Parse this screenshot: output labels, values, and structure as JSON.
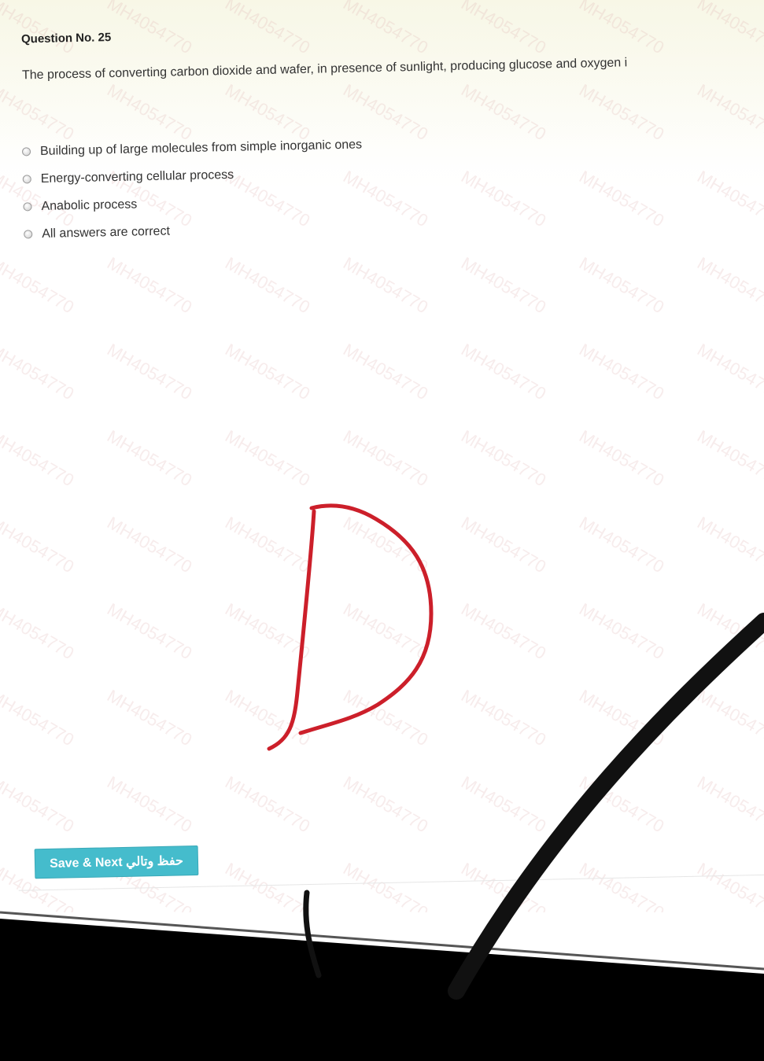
{
  "question": {
    "title": "Question No. 25",
    "text": "The process of converting carbon dioxide and wafer, in presence of sunlight, producing glucose and oxygen i"
  },
  "options": [
    {
      "label": "Building up of large molecules from simple inorganic ones"
    },
    {
      "label": "Energy-converting cellular process"
    },
    {
      "label": "Anabolic process"
    },
    {
      "label": "All answers are correct"
    }
  ],
  "save_button": {
    "label": "Save & Next حفظ وتالي"
  },
  "watermark": {
    "text": "MH4054770"
  },
  "handwriting": {
    "letter": "D",
    "color": "#cc1f2a"
  },
  "colors": {
    "button": "#45bccc",
    "watermark": "#dcaaaa",
    "bezel": "#000000"
  }
}
